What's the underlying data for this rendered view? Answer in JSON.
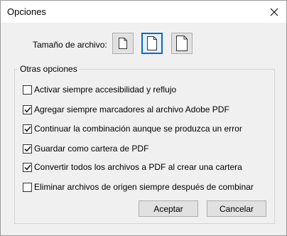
{
  "window": {
    "title": "Opciones"
  },
  "file_size": {
    "label": "Tamaño de archivo:",
    "options": [
      {
        "name": "small",
        "selected": false
      },
      {
        "name": "medium",
        "selected": true
      },
      {
        "name": "large",
        "selected": false
      }
    ]
  },
  "other_options": {
    "legend": "Otras opciones",
    "items": [
      {
        "label": "Activar siempre accesibilidad y reflujo",
        "checked": false
      },
      {
        "label": "Agregar siempre marcadores al archivo Adobe PDF",
        "checked": true
      },
      {
        "label": "Continuar la combinación aunque se produzca un error",
        "checked": true
      },
      {
        "label": "Guardar como cartera de PDF",
        "checked": true
      },
      {
        "label": "Convertir todos los archivos a PDF al crear una cartera",
        "checked": true
      },
      {
        "label": "Eliminar archivos de origen siempre después de combinar",
        "checked": false
      }
    ]
  },
  "buttons": {
    "accept": "Aceptar",
    "cancel": "Cancelar"
  }
}
